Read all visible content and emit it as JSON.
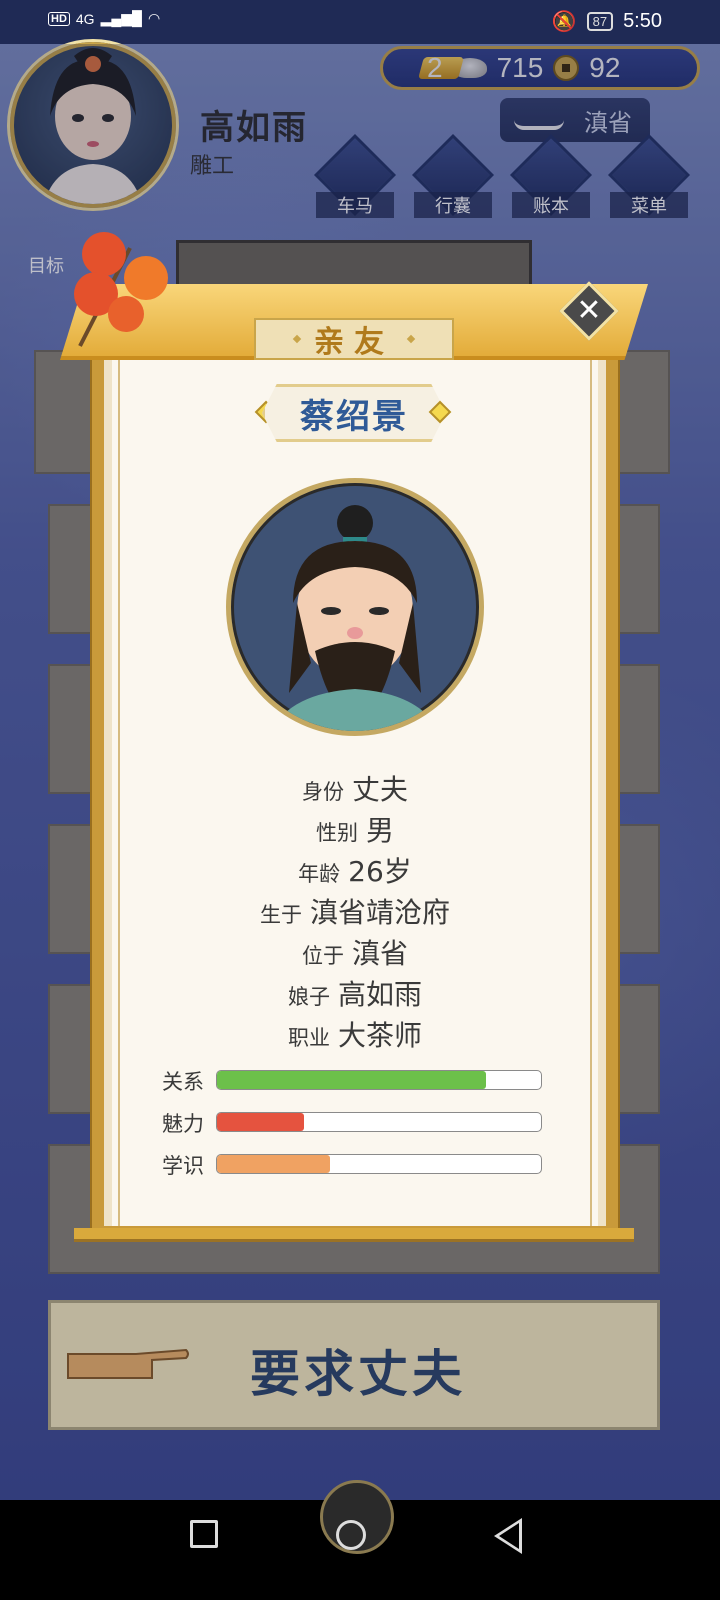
{
  "status_bar": {
    "network": "HD",
    "signal": "4G",
    "battery": "87",
    "time": "5:50"
  },
  "player": {
    "name": "高如雨",
    "occupation": "雕工"
  },
  "currency": {
    "gold": "2",
    "silver": "715",
    "copper": "92"
  },
  "location": "滇省",
  "menu": [
    {
      "label": "车马",
      "icon": "carriage-icon"
    },
    {
      "label": "行囊",
      "icon": "bag-icon"
    },
    {
      "label": "账本",
      "icon": "ledger-icon"
    },
    {
      "label": "菜单",
      "icon": "more-icon"
    }
  ],
  "target_label": "目标",
  "background_header": "亲友",
  "modal": {
    "title": "亲友",
    "person_name": "蔡绍景",
    "info": [
      {
        "key": "身份",
        "value": "丈夫"
      },
      {
        "key": "性别",
        "value": "男"
      },
      {
        "key": "年龄",
        "value": "26岁"
      },
      {
        "key": "生于",
        "value": "滇省靖沧府"
      },
      {
        "key": "位于",
        "value": "滇省"
      },
      {
        "key": "娘子",
        "value": "高如雨"
      },
      {
        "key": "职业",
        "value": "大茶师"
      }
    ],
    "stats": [
      {
        "label": "关系",
        "value": 0.83,
        "color": "#6cc04a"
      },
      {
        "label": "魅力",
        "value": 0.27,
        "color": "#e5533f"
      },
      {
        "label": "学识",
        "value": 0.35,
        "color": "#f0a262"
      }
    ]
  },
  "action_button": "要求丈夫"
}
